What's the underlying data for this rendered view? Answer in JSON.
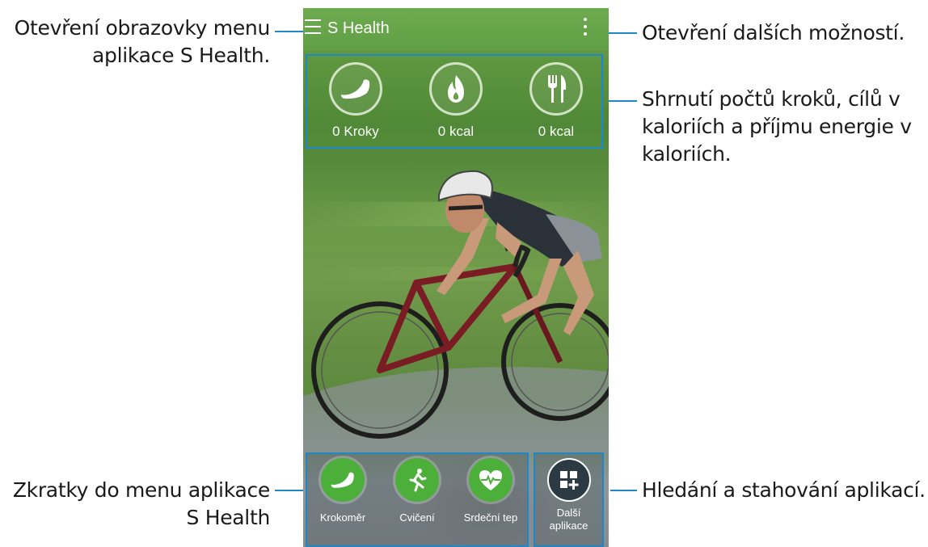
{
  "callouts": {
    "menu": [
      "Otevření obrazovky menu",
      "aplikace S Health."
    ],
    "more_options": [
      "Otevření dalších možností."
    ],
    "summary": [
      "Shrnutí počtů kroků, cílů v",
      "kaloriích a příjmu energie v",
      "kaloriích."
    ],
    "shortcuts": [
      "Zkratky do menu aplikace",
      "S Health"
    ],
    "apps": [
      "Hledání a stahování aplikací."
    ]
  },
  "app": {
    "title": "S Health"
  },
  "summary": {
    "items": [
      {
        "icon": "shoe-icon",
        "value": "0 Kroky"
      },
      {
        "icon": "flame-icon",
        "value": "0 kcal"
      },
      {
        "icon": "fork-knife-icon",
        "value": "0 kcal"
      }
    ]
  },
  "shortcuts": {
    "items": [
      {
        "icon": "shoe-icon",
        "label": "Krokoměr"
      },
      {
        "icon": "runner-icon",
        "label": "Cvičení"
      },
      {
        "icon": "heart-rate-icon",
        "label": "Srdeční tep"
      }
    ],
    "more_apps": {
      "icon": "grid-plus-icon",
      "label_line1": "Další",
      "label_line2": "aplikace"
    }
  },
  "colors": {
    "accent": "#1f86c7",
    "shortcut_green": "#4caf3a",
    "title_bar": "#62a44a"
  }
}
